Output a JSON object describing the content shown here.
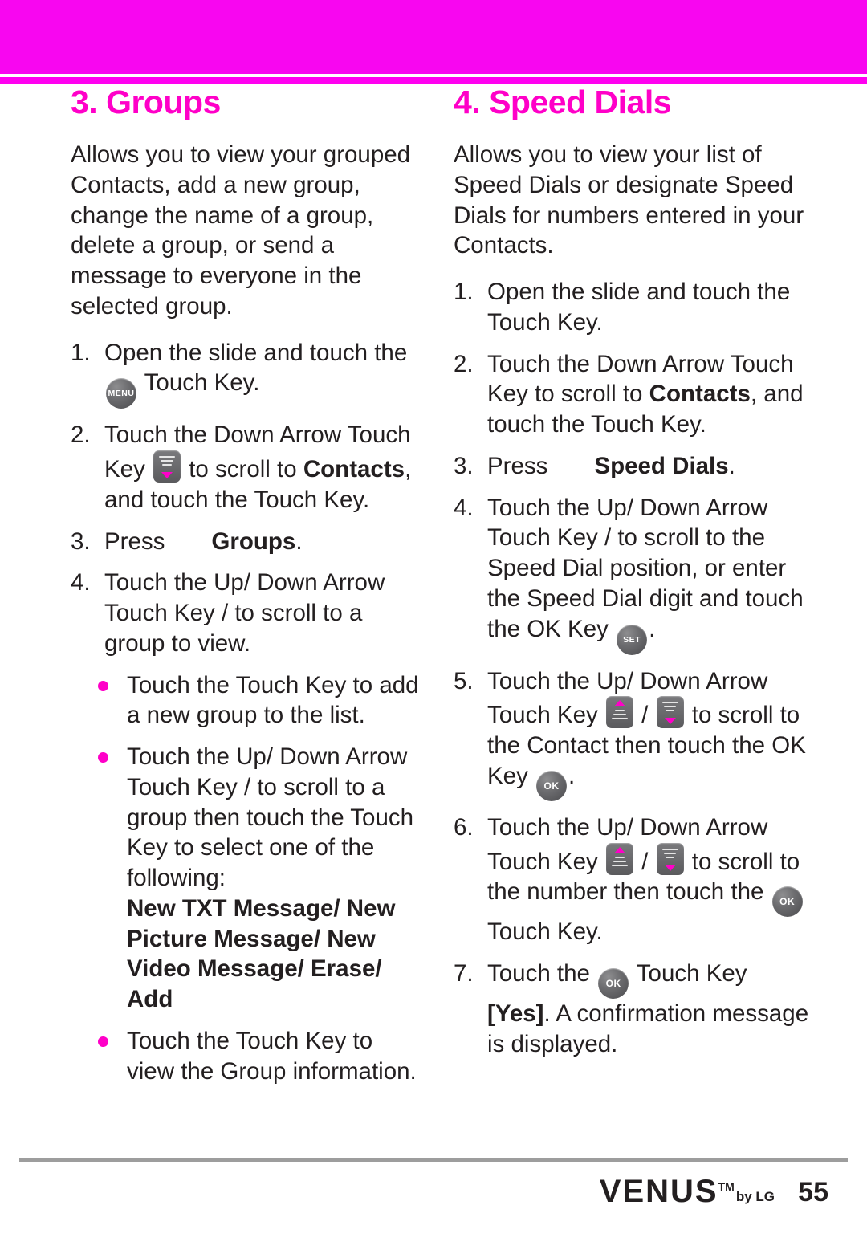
{
  "page": {
    "number": "55",
    "brand": "VENUS",
    "brand_tm": "TM",
    "brand_by": "by LG"
  },
  "left_column": {
    "title": "3. Groups",
    "intro": "Allows you to view your grouped Contacts, add a new group, change the name of a group, delete a group, or send a message to everyone in the selected group.",
    "steps": [
      {
        "num": "1.",
        "pre": "Open the slide and touch the ",
        "icon": "menu-key-icon",
        "post": " Touch Key."
      },
      {
        "num": "2.",
        "pre": "Touch the Down Arrow Touch Key ",
        "icon": "down-arrow-key-icon",
        "mid": " to scroll to ",
        "bold": "Contacts",
        "post": ", and touch the          Touch Key."
      },
      {
        "num": "3.",
        "pre": "Press",
        "bold": "Groups",
        "post": "."
      },
      {
        "num": "4.",
        "pre": "Touch the Up/ Down Arrow Touch Key          /          to scroll to a group to view."
      }
    ],
    "bullets": [
      {
        "text": "Touch the          Touch Key to add a new group to the list."
      },
      {
        "text": "Touch the Up/ Down Arrow Touch Key          /          to scroll to a group then touch the          Touch Key to select one of the following:",
        "bold_block": "New TXT Message/ New Picture Message/ New Video Message/ Erase/ Add"
      },
      {
        "text": "Touch the          Touch Key to view the Group information."
      }
    ]
  },
  "right_column": {
    "title": "4. Speed Dials",
    "intro": "Allows you to view your list of Speed Dials or designate Speed Dials for numbers entered in your Contacts.",
    "steps": [
      {
        "num": "1.",
        "pre": "Open the slide and touch the Touch Key."
      },
      {
        "num": "2.",
        "pre": "Touch the Down Arrow Touch Key          to scroll to ",
        "bold": "Contacts",
        "post": ", and touch the          Touch Key."
      },
      {
        "num": "3.",
        "pre": "Press",
        "bold": "Speed Dials",
        "post": "."
      },
      {
        "num": "4.",
        "pre": "Touch the Up/ Down Arrow Touch Key          /          to scroll to the Speed Dial position, or enter the Speed Dial digit and touch the OK Key ",
        "icon": "set-key-icon",
        "post": "."
      },
      {
        "num": "5.",
        "pre": "Touch the Up/ Down Arrow Touch Key ",
        "icon1": "up-arrow-key-icon",
        "sep": " / ",
        "icon2": "down-arrow-key-icon",
        "mid": " to scroll to the Contact then touch the OK Key ",
        "icon3": "ok-key-icon",
        "post": "."
      },
      {
        "num": "6.",
        "pre": "Touch the Up/ Down Arrow Touch Key ",
        "icon1": "up-arrow-key-icon",
        "sep": " / ",
        "icon2": "down-arrow-key-icon",
        "mid": " to scroll to the number then touch the ",
        "icon3": "ok-key-icon",
        "post": " Touch Key."
      },
      {
        "num": "7.",
        "pre": "Touch the ",
        "icon": "ok-key-icon",
        "mid": " Touch Key ",
        "bold": "[Yes]",
        "post": ". A confirmation message is displayed."
      }
    ]
  },
  "icons": {
    "menu_label": "MENU",
    "set_label": "SET",
    "ok_label": "OK"
  },
  "colors": {
    "accent": "#ff00c8",
    "band": "#ff00f0",
    "text": "#231f20"
  }
}
